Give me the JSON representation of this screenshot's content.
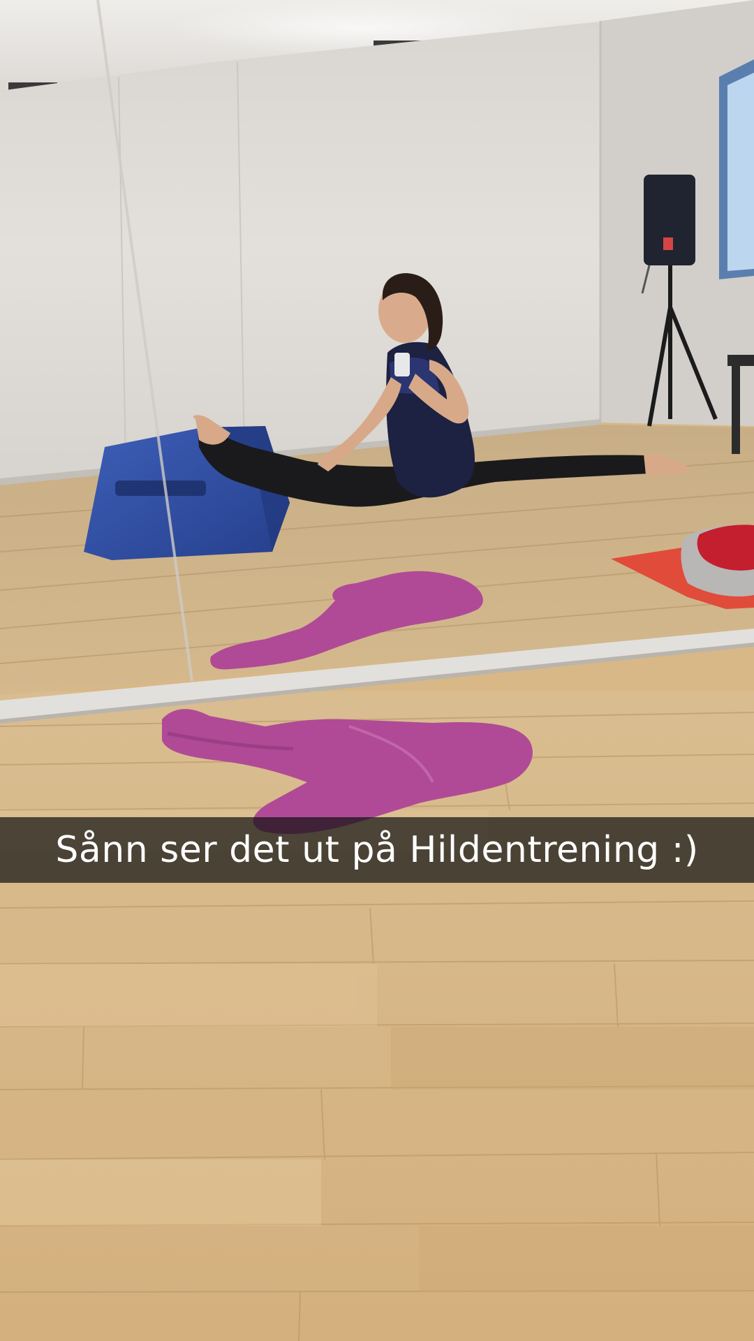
{
  "snap": {
    "caption": "Sånn ser det ut på Hildentrening :)"
  },
  "colors": {
    "wall": "#dedbd7",
    "floor": "#d6b483",
    "towel": "#b04a96",
    "vault_block": "#2f4ea3",
    "caption_bar": "#141414"
  }
}
